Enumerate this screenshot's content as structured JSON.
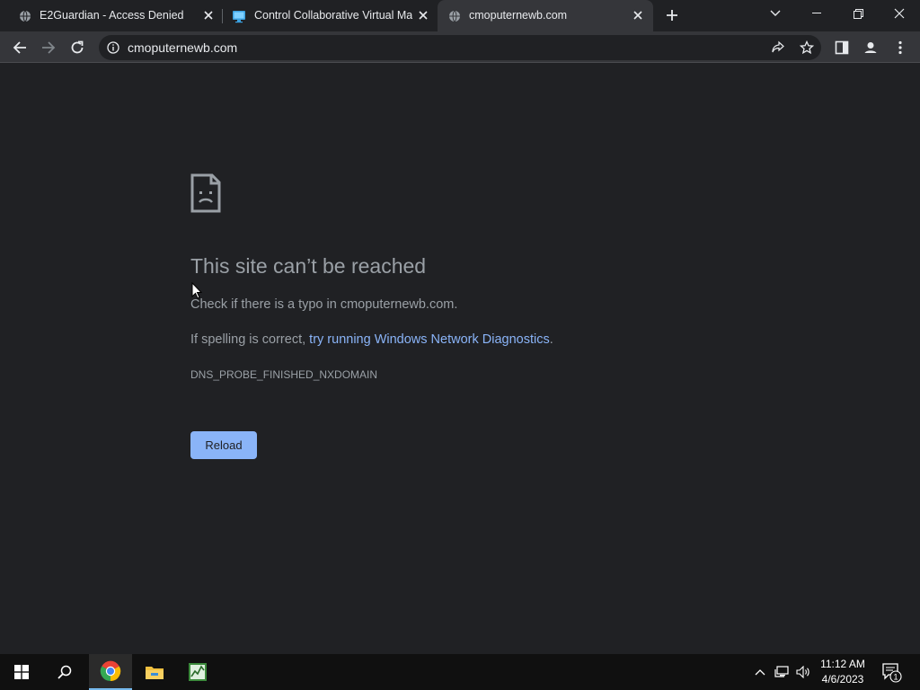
{
  "tabs": [
    {
      "title": "E2Guardian - Access Denied",
      "icon": "globe-icon",
      "active": false
    },
    {
      "title": "Control Collaborative Virtual Mac",
      "icon": "monitor-icon",
      "active": false
    },
    {
      "title": "cmoputernewb.com",
      "icon": "globe-icon",
      "active": true
    }
  ],
  "toolbar": {
    "url": "cmoputernewb.com"
  },
  "error": {
    "title": "This site can’t be reached",
    "line1": "Check if there is a typo in cmoputernewb.com.",
    "line2_prefix": "If spelling is correct, ",
    "line2_link": "try running Windows Network Diagnostics",
    "line2_suffix": ".",
    "code": "DNS_PROBE_FINISHED_NXDOMAIN",
    "reload_label": "Reload"
  },
  "taskbar": {
    "time": "11:12 AM",
    "date": "4/6/2023",
    "notification_count": "1",
    "apps": [
      "start-icon",
      "search-icon",
      "chrome-icon",
      "file-explorer-icon",
      "task-manager-icon"
    ]
  },
  "colors": {
    "background": "#202124",
    "toolbar": "#35363a",
    "link": "#8ab4f8",
    "text_muted": "#9aa0a6"
  }
}
